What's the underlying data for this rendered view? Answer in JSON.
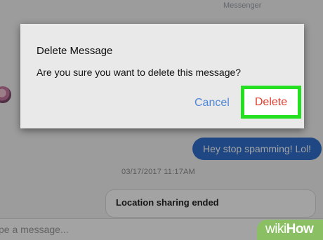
{
  "chat": {
    "top_sender_label": "Messenger",
    "outgoing_message": "Hey stop spamming! Lol!",
    "timestamp": "03/17/2017 11:17AM",
    "location_card_text": "Location sharing ended",
    "composer_placeholder": "ype a message..."
  },
  "dialog": {
    "title": "Delete Message",
    "body": "Are you sure you want to delete this message?",
    "cancel_label": "Cancel",
    "delete_label": "Delete",
    "highlight_color": "#24e020"
  },
  "colors": {
    "bubble_blue": "#2f6fcf",
    "cancel_blue": "#4f86d6",
    "delete_red": "#e23b2e"
  },
  "watermark": {
    "part1": "wiki",
    "part2": "How",
    "color": "#8bbf63"
  }
}
